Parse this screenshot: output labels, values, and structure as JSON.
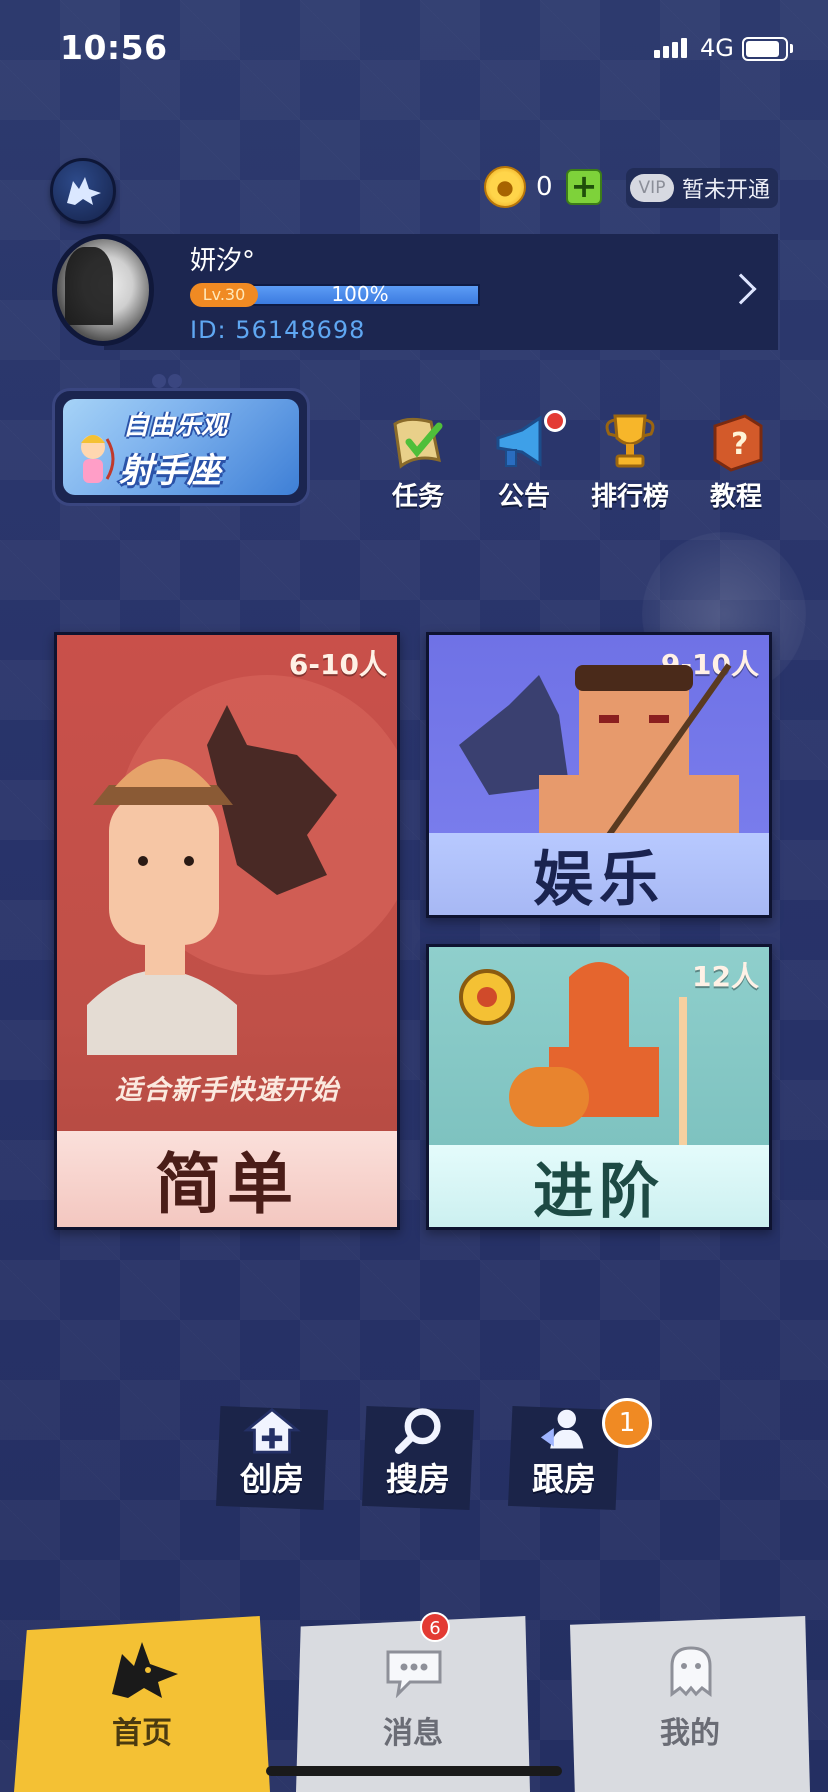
{
  "status_bar": {
    "time": "10:56",
    "network": "4G"
  },
  "header": {
    "coins": "0",
    "vip_tag": "VIP",
    "vip_status": "暂未开通"
  },
  "profile": {
    "name": "妍汐°",
    "level": "Lv.30",
    "progress_label": "100%",
    "progress_fraction": 1.0,
    "id_label": "ID:",
    "id_value": "56148698"
  },
  "banner": {
    "line1": "自由乐观",
    "line2": "射手座"
  },
  "shortcuts": [
    {
      "label": "任务",
      "icon": "scroll-check-icon"
    },
    {
      "label": "公告",
      "icon": "megaphone-icon"
    },
    {
      "label": "排行榜",
      "icon": "trophy-icon"
    },
    {
      "label": "教程",
      "icon": "question-book-icon"
    }
  ],
  "modes": {
    "easy": {
      "title": "简单",
      "players": "6-10人",
      "subtitle": "适合新手快速开始"
    },
    "fun": {
      "title": "娱乐",
      "players": "9-10人"
    },
    "advanced": {
      "title": "进阶",
      "players": "12人"
    }
  },
  "room_actions": [
    {
      "label": "创房",
      "icon": "house-plus-icon"
    },
    {
      "label": "搜房",
      "icon": "magnifier-icon"
    },
    {
      "label": "跟房",
      "icon": "follow-user-icon",
      "badge": "1"
    }
  ],
  "tabs": [
    {
      "label": "首页",
      "icon": "wolf-head-icon",
      "active": true
    },
    {
      "label": "消息",
      "icon": "chat-bubble-icon",
      "badge": "6"
    },
    {
      "label": "我的",
      "icon": "ghost-user-icon"
    }
  ],
  "colors": {
    "background": "#2a3566",
    "accent_yellow": "#f4c134",
    "easy_card": "#c9504a",
    "fun_card": "#6f72e6",
    "advanced_card": "#8fcfcc",
    "badge_red": "#e33a33",
    "badge_orange": "#f08a23"
  }
}
